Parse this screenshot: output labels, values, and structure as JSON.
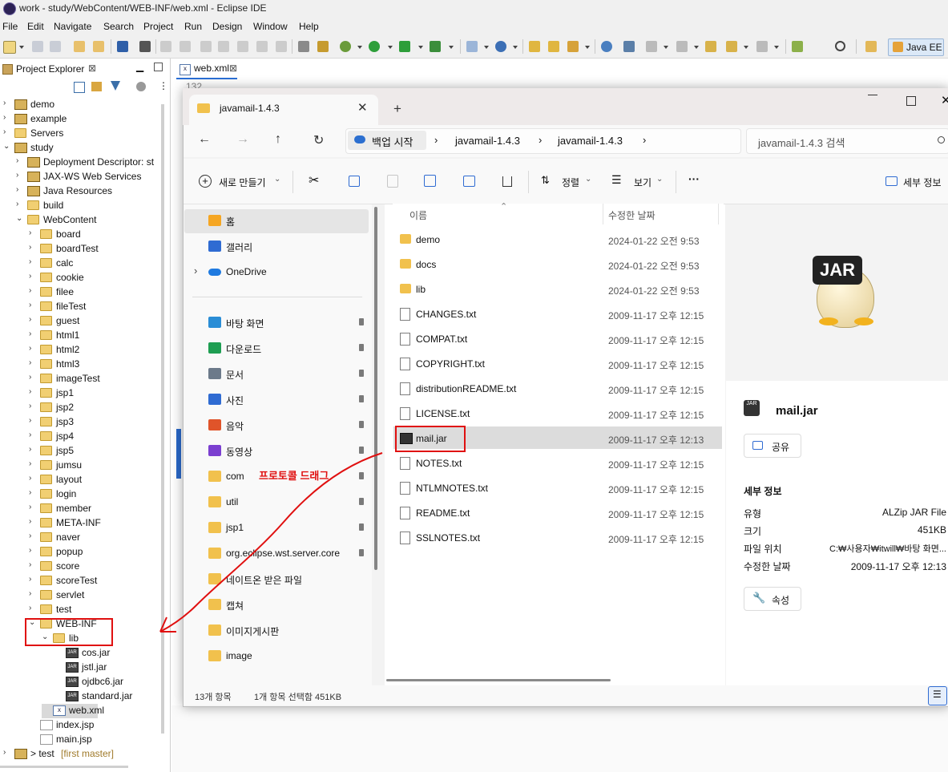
{
  "window_title": "work - study/WebContent/WEB-INF/web.xml - Eclipse IDE",
  "menu": [
    "File",
    "Edit",
    "Navigate",
    "Search",
    "Project",
    "Run",
    "Design",
    "Window",
    "Help"
  ],
  "perspective_label": "Java EE",
  "project_explorer": {
    "title": "Project Explorer",
    "close": "⊠",
    "tree": [
      {
        "label": "demo",
        "suffix": ""
      },
      {
        "label": "example",
        "suffix": ""
      },
      {
        "label": "Servers",
        "suffix": ""
      },
      {
        "label": "study",
        "suffix": ""
      },
      {
        "label": "Deployment Descriptor: st",
        "suffix": ""
      },
      {
        "label": "JAX-WS Web Services",
        "suffix": ""
      },
      {
        "label": "Java Resources",
        "suffix": ""
      },
      {
        "label": "build",
        "suffix": ""
      },
      {
        "label": "WebContent",
        "suffix": ""
      },
      {
        "label": "board",
        "suffix": ""
      },
      {
        "label": "boardTest",
        "suffix": ""
      },
      {
        "label": "calc",
        "suffix": ""
      },
      {
        "label": "cookie",
        "suffix": ""
      },
      {
        "label": "filee",
        "suffix": ""
      },
      {
        "label": "fileTest",
        "suffix": ""
      },
      {
        "label": "guest",
        "suffix": ""
      },
      {
        "label": "html1",
        "suffix": ""
      },
      {
        "label": "html2",
        "suffix": ""
      },
      {
        "label": "html3",
        "suffix": ""
      },
      {
        "label": "imageTest",
        "suffix": ""
      },
      {
        "label": "jsp1",
        "suffix": ""
      },
      {
        "label": "jsp2",
        "suffix": ""
      },
      {
        "label": "jsp3",
        "suffix": ""
      },
      {
        "label": "jsp4",
        "suffix": ""
      },
      {
        "label": "jsp5",
        "suffix": ""
      },
      {
        "label": "jumsu",
        "suffix": ""
      },
      {
        "label": "layout",
        "suffix": ""
      },
      {
        "label": "login",
        "suffix": ""
      },
      {
        "label": "member",
        "suffix": ""
      },
      {
        "label": "META-INF",
        "suffix": ""
      },
      {
        "label": "naver",
        "suffix": ""
      },
      {
        "label": "popup",
        "suffix": ""
      },
      {
        "label": "score",
        "suffix": ""
      },
      {
        "label": "scoreTest",
        "suffix": ""
      },
      {
        "label": "servlet",
        "suffix": ""
      },
      {
        "label": "test",
        "suffix": ""
      },
      {
        "label": "WEB-INF",
        "suffix": ""
      },
      {
        "label": "lib",
        "suffix": ""
      },
      {
        "label": "cos.jar",
        "suffix": ""
      },
      {
        "label": "jstl.jar",
        "suffix": ""
      },
      {
        "label": "ojdbc6.jar",
        "suffix": ""
      },
      {
        "label": "standard.jar",
        "suffix": ""
      },
      {
        "label": "web.xml",
        "suffix": ""
      },
      {
        "label": "index.jsp",
        "suffix": ""
      },
      {
        "label": "main.jsp",
        "suffix": ""
      },
      {
        "label": "> test",
        "suffix": "[first master]"
      }
    ]
  },
  "editor": {
    "tab_label": "web.xml",
    "line_number": "132"
  },
  "file_explorer": {
    "tab_title": "javamail-1.4.3",
    "tab_plus": "+",
    "breadcrumb": [
      "백업 시작",
      "javamail-1.4.3",
      "javamail-1.4.3"
    ],
    "search_placeholder": "javamail-1.4.3 검색",
    "commands": {
      "new": "새로 만들기",
      "sort": "정렬",
      "view": "보기",
      "more": "···",
      "details": "세부 정보"
    },
    "nav_items": [
      {
        "label": "홈",
        "icon": "home-icon",
        "pinned": false
      },
      {
        "label": "갤러리",
        "icon": "gallery-icon",
        "pinned": false
      },
      {
        "label": "OneDrive",
        "icon": "cloud-icon",
        "pinned": false
      },
      {
        "label": "바탕 화면",
        "icon": "desktop-icon",
        "pinned": true
      },
      {
        "label": "다운로드",
        "icon": "download-icon",
        "pinned": true
      },
      {
        "label": "문서",
        "icon": "document-icon",
        "pinned": true
      },
      {
        "label": "사진",
        "icon": "picture-icon",
        "pinned": true
      },
      {
        "label": "음악",
        "icon": "music-icon",
        "pinned": true
      },
      {
        "label": "동영상",
        "icon": "video-icon",
        "pinned": true
      },
      {
        "label": "com",
        "icon": "folder-icon",
        "pinned": true
      },
      {
        "label": "util",
        "icon": "folder-icon",
        "pinned": true
      },
      {
        "label": "jsp1",
        "icon": "folder-icon",
        "pinned": true
      },
      {
        "label": "org.eclipse.wst.server.core",
        "icon": "folder-icon",
        "pinned": true
      },
      {
        "label": "네이트온 받은 파일",
        "icon": "folder-icon",
        "pinned": false
      },
      {
        "label": "캡쳐",
        "icon": "folder-icon",
        "pinned": false
      },
      {
        "label": "이미지게시판",
        "icon": "folder-icon",
        "pinned": false
      },
      {
        "label": "image",
        "icon": "folder-icon",
        "pinned": false
      }
    ],
    "columns": {
      "name": "이름",
      "modified": "수정한 날짜"
    },
    "files": [
      {
        "name": "demo",
        "date": "2024-01-22 오전 9:53",
        "kind": "folder"
      },
      {
        "name": "docs",
        "date": "2024-01-22 오전 9:53",
        "kind": "folder"
      },
      {
        "name": "lib",
        "date": "2024-01-22 오전 9:53",
        "kind": "folder"
      },
      {
        "name": "CHANGES.txt",
        "date": "2009-11-17 오후 12:15",
        "kind": "txt"
      },
      {
        "name": "COMPAT.txt",
        "date": "2009-11-17 오후 12:15",
        "kind": "txt"
      },
      {
        "name": "COPYRIGHT.txt",
        "date": "2009-11-17 오후 12:15",
        "kind": "txt"
      },
      {
        "name": "distributionREADME.txt",
        "date": "2009-11-17 오후 12:15",
        "kind": "txt"
      },
      {
        "name": "LICENSE.txt",
        "date": "2009-11-17 오후 12:15",
        "kind": "txt"
      },
      {
        "name": "mail.jar",
        "date": "2009-11-17 오후 12:13",
        "kind": "jar"
      },
      {
        "name": "NOTES.txt",
        "date": "2009-11-17 오후 12:15",
        "kind": "txt"
      },
      {
        "name": "NTLMNOTES.txt",
        "date": "2009-11-17 오후 12:15",
        "kind": "txt"
      },
      {
        "name": "README.txt",
        "date": "2009-11-17 오후 12:15",
        "kind": "txt"
      },
      {
        "name": "SSLNOTES.txt",
        "date": "2009-11-17 오후 12:15",
        "kind": "txt"
      }
    ],
    "details_pane": {
      "badge": "JAR",
      "file_name": "mail.jar",
      "share": "공유",
      "section_title": "세부 정보",
      "rows": [
        {
          "label": "유형",
          "value": "ALZip JAR File"
        },
        {
          "label": "크기",
          "value": "451KB"
        },
        {
          "label": "파일 위치",
          "value": "C:₩사용자₩itwill₩바탕 화면..."
        },
        {
          "label": "수정한 날짜",
          "value": "2009-11-17 오후 12:13"
        }
      ],
      "properties": "속성"
    },
    "status": {
      "count": "13개 항목",
      "selection": "1개 항목 선택함 451KB"
    }
  },
  "annotation": {
    "text": "프로토콜 드래그",
    "color": "#e01010"
  }
}
